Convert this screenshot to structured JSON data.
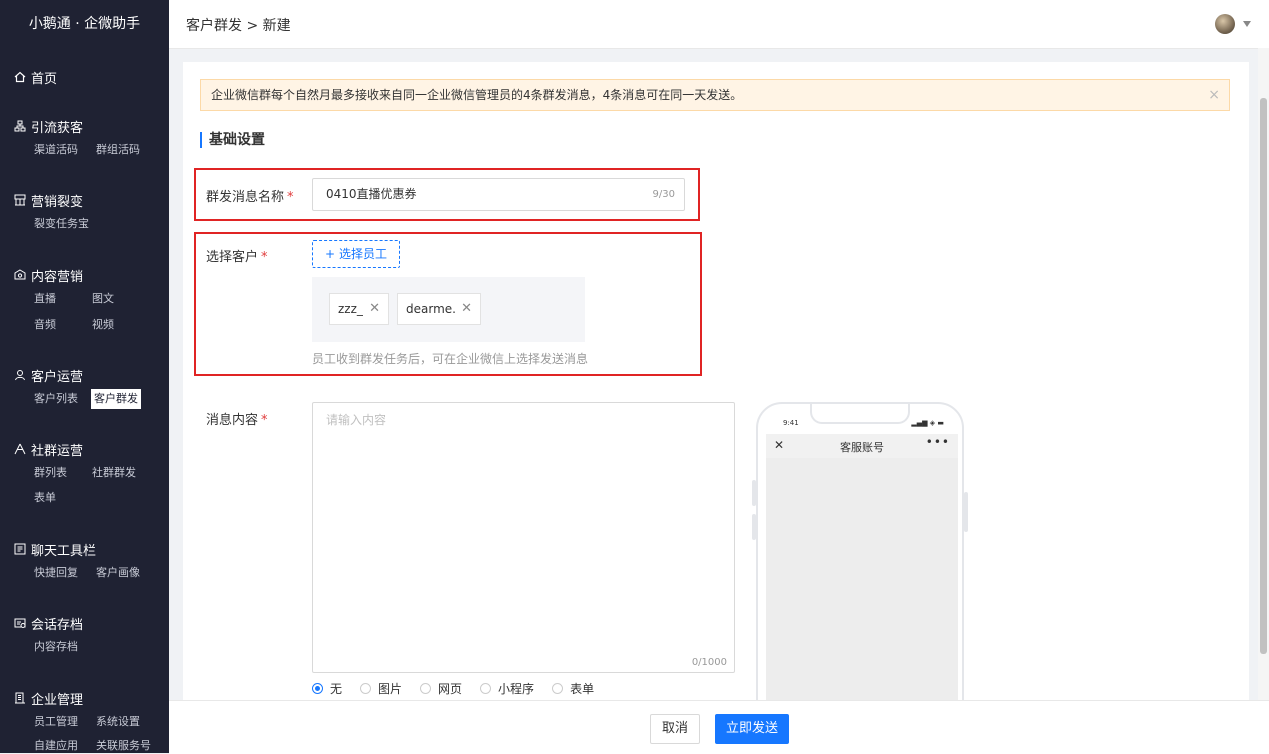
{
  "sidebar": {
    "brand": "小鹅通 · 企微助手",
    "groups": [
      {
        "title": "首页",
        "icon": "home-icon",
        "items": []
      },
      {
        "title": "引流获客",
        "icon": "network-icon",
        "items": [
          "渠道活码",
          "群组活码"
        ]
      },
      {
        "title": "营销裂变",
        "icon": "split-icon",
        "items": [
          "裂变任务宝"
        ]
      },
      {
        "title": "内容营销",
        "icon": "content-icon",
        "items": [
          "直播",
          "图文",
          "音频",
          "视频"
        ]
      },
      {
        "title": "客户运营",
        "icon": "user-icon",
        "items": [
          "客户列表",
          "客户群发"
        ]
      },
      {
        "title": "社群运营",
        "icon": "community-icon",
        "items": [
          "群列表",
          "社群群发",
          "表单"
        ]
      },
      {
        "title": "聊天工具栏",
        "icon": "toolbar-icon",
        "items": [
          "快捷回复",
          "客户画像"
        ]
      },
      {
        "title": "会话存档",
        "icon": "archive-icon",
        "items": [
          "内容存档"
        ]
      },
      {
        "title": "企业管理",
        "icon": "building-icon",
        "items": [
          "员工管理",
          "系统设置",
          "自建应用",
          "关联服务号"
        ]
      }
    ],
    "active_item": "客户群发"
  },
  "header": {
    "breadcrumb": "客户群发 > 新建",
    "avatar_icon": "avatar-icon"
  },
  "alert": {
    "text": "企业微信群每个自然月最多接收来自同一企业微信管理员的4条群发消息，4条消息可在同一天发送。",
    "close": "×"
  },
  "form": {
    "section_title": "基础设置",
    "name_label": "群发消息名称",
    "name_value": "0410直播优惠券",
    "name_counter": "9/30",
    "customer_label": "选择客户",
    "pick_button": "选择员工",
    "pick_icon": "+",
    "tags": [
      "zzz_",
      "dearme."
    ],
    "tag_close": "✕",
    "customer_hint": "员工收到群发任务后，可在企业微信上选择发送消息",
    "content_label": "消息内容",
    "content_placeholder": "请输入内容",
    "content_counter": "0/1000",
    "required_mark": "*",
    "attach_options": [
      "无",
      "图片",
      "网页",
      "小程序",
      "表单"
    ],
    "attach_selected": "无"
  },
  "phone": {
    "time": "9:41",
    "status": "▂▄▆ ◈ ▬",
    "close": "✕",
    "title": "客服账号",
    "more": "•••"
  },
  "footer": {
    "cancel": "取消",
    "send": "立即发送"
  },
  "colors": {
    "primary": "#1677ff",
    "sidebar_bg": "#1f2233",
    "highlight_box": "#e02424",
    "alert_bg": "#fff4e5"
  }
}
